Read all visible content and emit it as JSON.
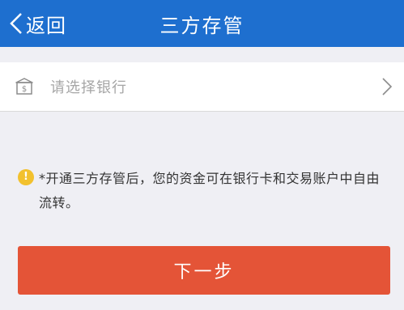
{
  "header": {
    "back_label": "返回",
    "title": "三方存管"
  },
  "bank_select": {
    "placeholder": "请选择银行",
    "icon": "bank-card-icon"
  },
  "notice": {
    "icon": "info-icon",
    "text": "*开通三方存管后，您的资金可在银行卡和交易账户中自由流转。"
  },
  "next_button": {
    "label": "下一步"
  },
  "colors": {
    "header_bg": "#1e6fcf",
    "button_bg": "#e45437",
    "info_icon": "#f2c12e",
    "page_bg": "#efeff4"
  }
}
